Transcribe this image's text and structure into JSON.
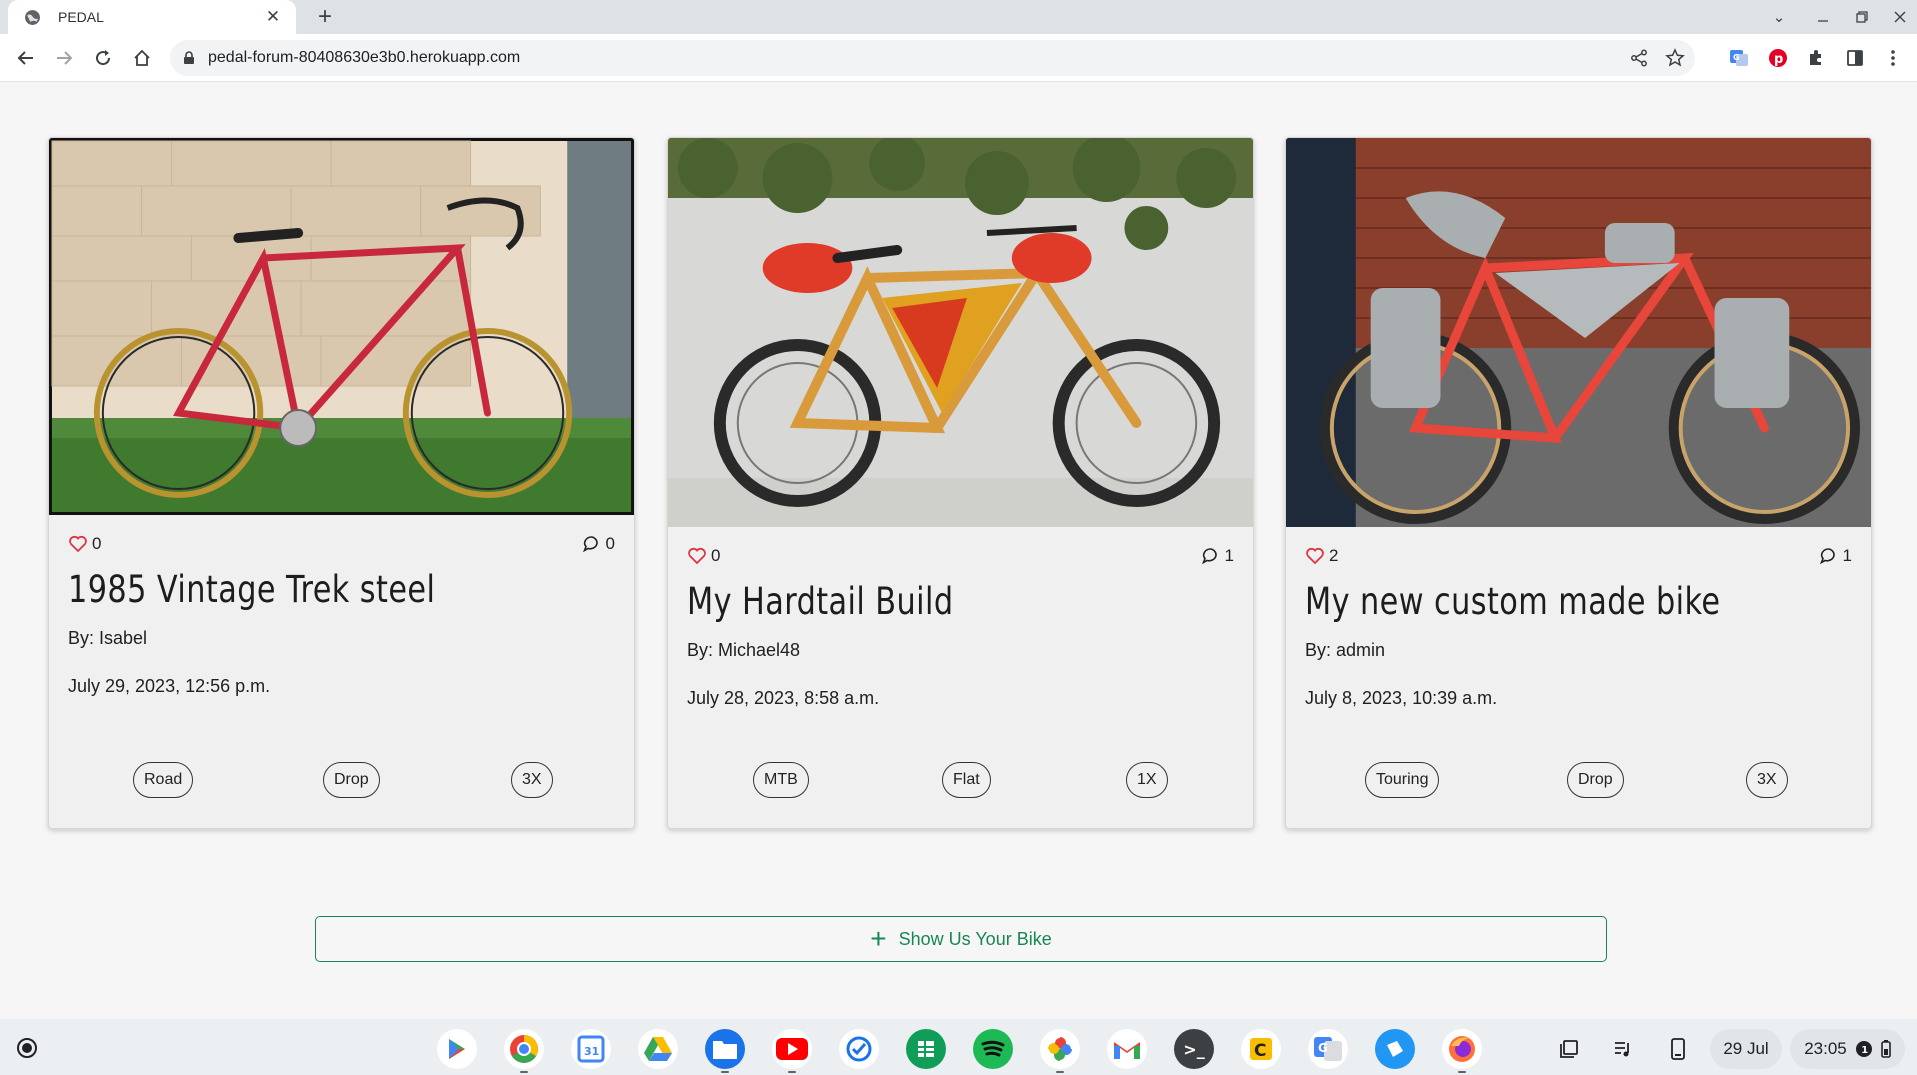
{
  "browser": {
    "tab_title": "PEDAL",
    "url": "pedal-forum-80408630e3b0.herokuapp.com"
  },
  "posts": [
    {
      "title": "1985 Vintage Trek steel",
      "author": "By: Isabel",
      "date": "July 29, 2023, 12:56 p.m.",
      "likes": "0",
      "comments": "0",
      "tags": [
        "Road",
        "Drop",
        "3X"
      ],
      "frame_color": "#c8283c"
    },
    {
      "title": "My Hardtail Build",
      "author": "By: Michael48",
      "date": "July 28, 2023, 8:58 a.m.",
      "likes": "0",
      "comments": "1",
      "tags": [
        "MTB",
        "Flat",
        "1X"
      ],
      "frame_color": "#d89a3a"
    },
    {
      "title": "My new custom made bike",
      "author": "By: admin",
      "date": "July 8, 2023, 10:39 a.m.",
      "likes": "2",
      "comments": "1",
      "tags": [
        "Touring",
        "Drop",
        "3X"
      ],
      "frame_color": "#e8463a"
    }
  ],
  "cta": {
    "label": "Show Us Your Bike"
  },
  "shelf": {
    "apps": [
      "play-store",
      "chrome",
      "calendar",
      "drive",
      "files",
      "youtube",
      "tasks",
      "sheets",
      "spotify",
      "photos",
      "gmail",
      "terminal",
      "caret",
      "translate",
      "app-tablet",
      "firefox"
    ],
    "calendar_label": "31",
    "date": "29 Jul",
    "time": "23:05"
  },
  "colors": {
    "heart": "#dc3545",
    "accent_green": "#198754"
  }
}
